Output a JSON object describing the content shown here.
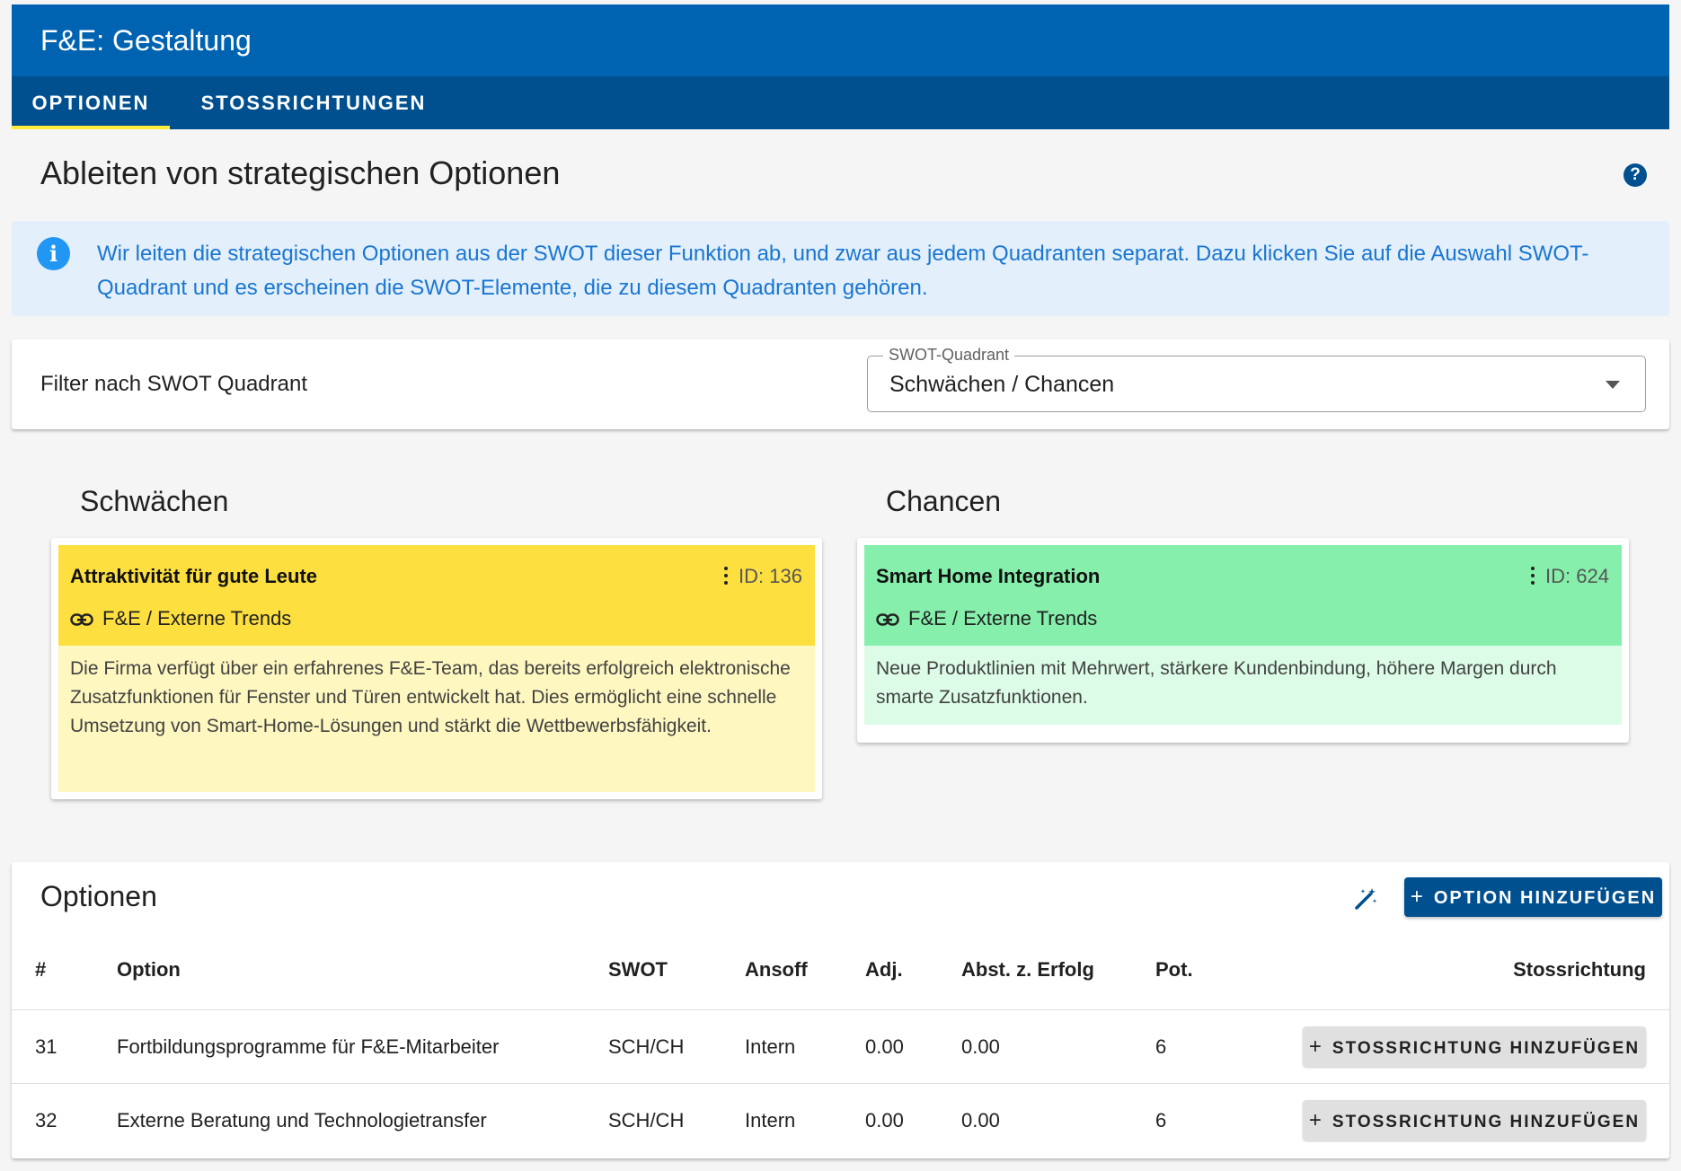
{
  "app": {
    "title": "F&E: Gestaltung",
    "tabs": [
      {
        "label": "OPTIONEN",
        "active": true
      },
      {
        "label": "STOSSRICHTUNGEN",
        "active": false
      }
    ]
  },
  "page": {
    "title": "Ableiten von strategischen Optionen",
    "help_icon": "help-circle-icon"
  },
  "alert": {
    "icon": "info-icon",
    "text": "Wir leiten die strategischen Optionen aus der SWOT dieser Funktion ab, und zwar aus jedem Quadranten separat. Dazu klicken Sie auf die Auswahl SWOT-Quadrant und es erscheinen die SWOT-Elemente, die zu diesem Quadranten gehören."
  },
  "filter": {
    "label": "Filter nach SWOT Quadrant",
    "select_label": "SWOT-Quadrant",
    "select_value": "Schwächen / Chancen"
  },
  "swot": {
    "left": {
      "heading": "Schwächen",
      "card": {
        "title": "Attraktivität für gute Leute",
        "id": "ID: 136",
        "link": "F&E / Externe Trends",
        "body": "Die Firma verfügt über ein erfahrenes F&E-Team, das bereits erfolgreich elektronische Zusatzfunktionen für Fenster und Türen entwickelt hat. Dies ermöglicht eine schnelle Umsetzung von Smart-Home-Lösungen und stärkt die Wettbewerbsfähigkeit.",
        "head_color": "#fddf3f",
        "body_color": "#fef7c0"
      }
    },
    "right": {
      "heading": "Chancen",
      "card": {
        "title": "Smart Home Integration",
        "id": "ID: 624",
        "link": "F&E / Externe Trends",
        "body": "Neue Produktlinien mit Mehrwert, stärkere Kundenbindung, höhere Margen durch smarte Zusatzfunktionen.",
        "head_color": "#86efac",
        "body_color": "#dcfce7"
      }
    }
  },
  "options": {
    "title": "Optionen",
    "add_button": "OPTION HINZUFÜGEN",
    "columns": [
      "#",
      "Option",
      "SWOT",
      "Ansoff",
      "Adj.",
      "Abst. z. Erfolg",
      "Pot.",
      "Stossrichtung"
    ],
    "rows": [
      {
        "num": "31",
        "option": "Fortbildungsprogramme für F&E-Mitarbeiter",
        "swot": "SCH/CH",
        "ansoff": "Intern",
        "adj": "0.00",
        "abst": "0.00",
        "pot": "6",
        "button": "STOSSRICHTUNG HINZUFÜGEN"
      },
      {
        "num": "32",
        "option": "Externe Beratung und Technologietransfer",
        "swot": "SCH/CH",
        "ansoff": "Intern",
        "adj": "0.00",
        "abst": "0.00",
        "pot": "6",
        "button": "STOSSRICHTUNG HINZUFÜGEN"
      }
    ]
  }
}
